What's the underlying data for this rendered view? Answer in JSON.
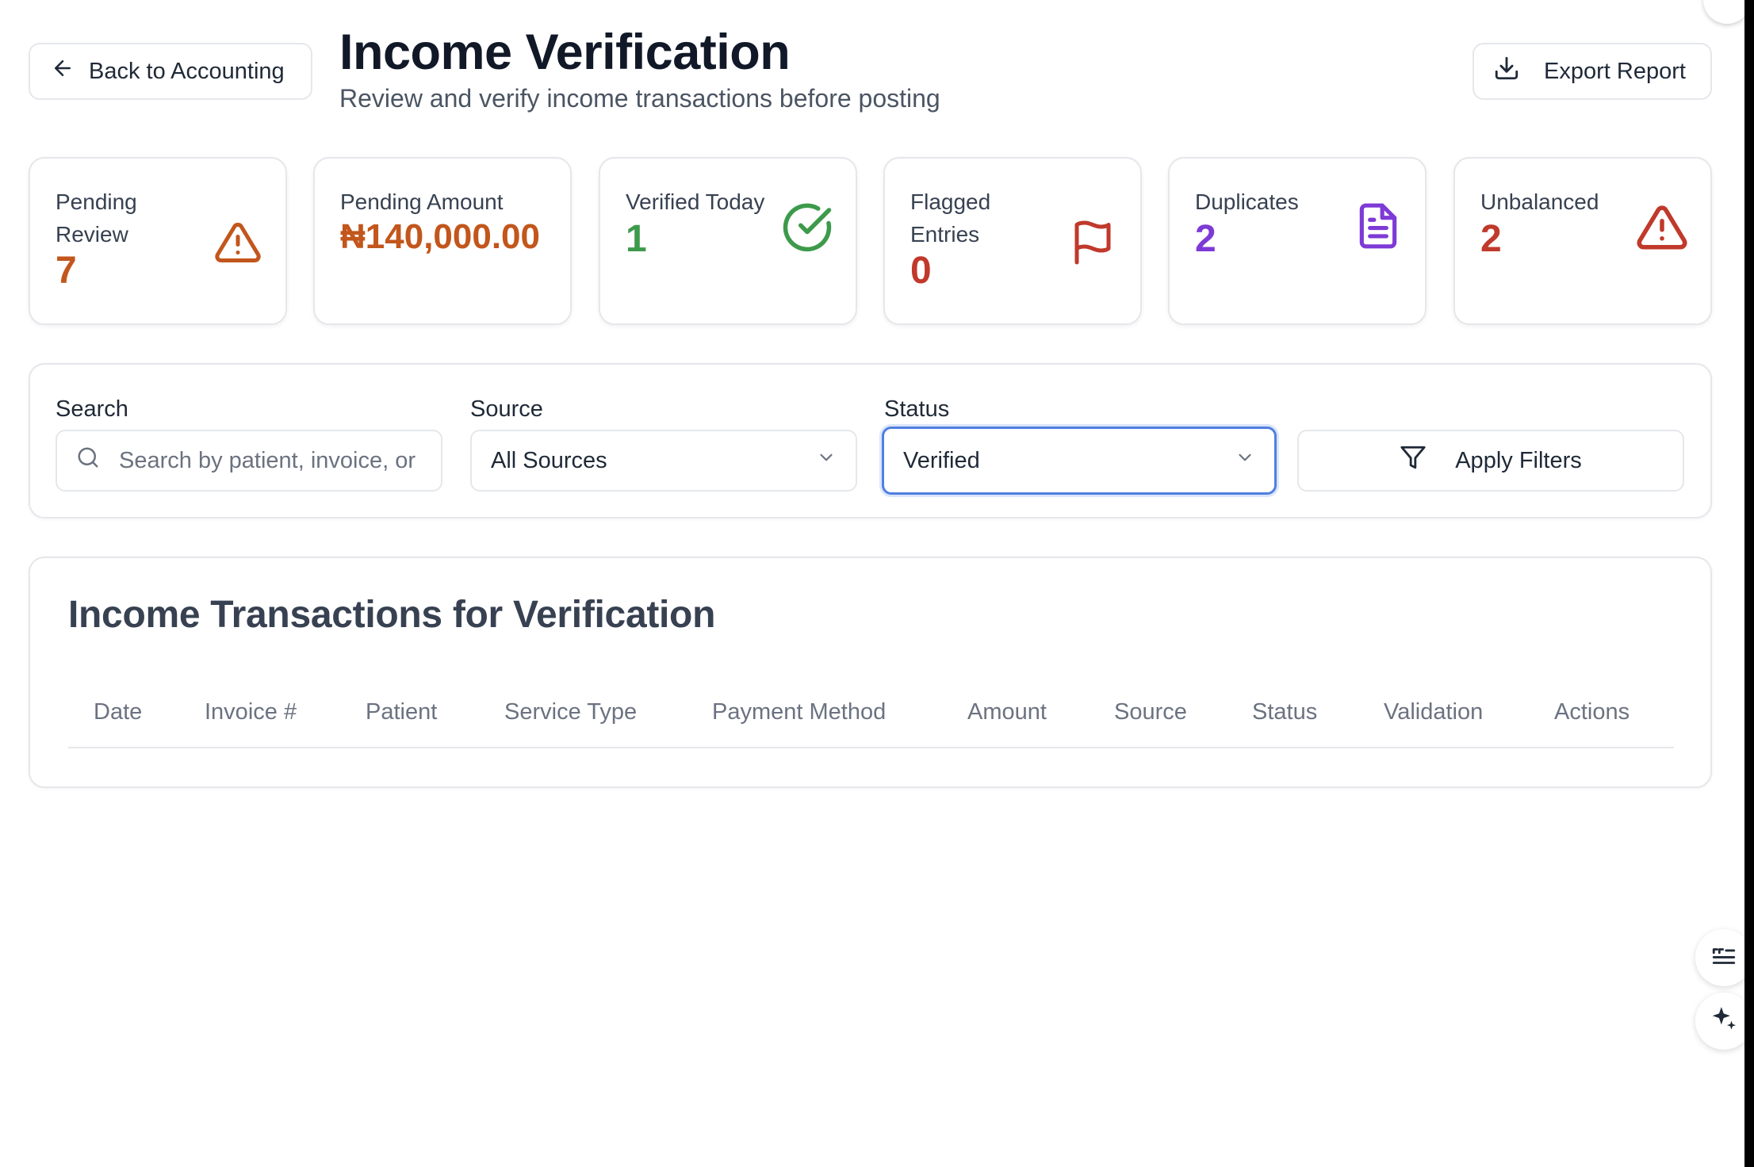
{
  "header": {
    "back_label": "Back to Accounting",
    "title": "Income Verification",
    "subtitle": "Review and verify income transactions before posting",
    "export_label": "Export Report"
  },
  "stats": [
    {
      "label": "Pending Review",
      "value": "7",
      "color": "#c2561c",
      "icon": "warning-triangle-icon"
    },
    {
      "label": "Pending Amount",
      "value": "₦140,000.00",
      "color": "#c2561c",
      "icon": ""
    },
    {
      "label": "Verified Today",
      "value": "1",
      "color": "#3d9a4b",
      "icon": "check-circle-icon"
    },
    {
      "label": "Flagged Entries",
      "value": "0",
      "color": "#c0392b",
      "icon": "flag-icon"
    },
    {
      "label": "Duplicates",
      "value": "2",
      "color": "#7e3ad6",
      "icon": "document-icon"
    },
    {
      "label": "Unbalanced",
      "value": "2",
      "color": "#c0392b",
      "icon": "alert-triangle-icon"
    }
  ],
  "filters": {
    "search_label": "Search",
    "search_placeholder": "Search by patient, invoice, or",
    "source_label": "Source",
    "source_value": "All Sources",
    "status_label": "Status",
    "status_value": "Verified",
    "apply_label": "Apply Filters"
  },
  "table": {
    "title": "Income Transactions for Verification",
    "columns": [
      "Date",
      "Invoice #",
      "Patient",
      "Service Type",
      "Payment Method",
      "Amount",
      "Source",
      "Status",
      "Validation",
      "Actions"
    ],
    "rows": []
  }
}
